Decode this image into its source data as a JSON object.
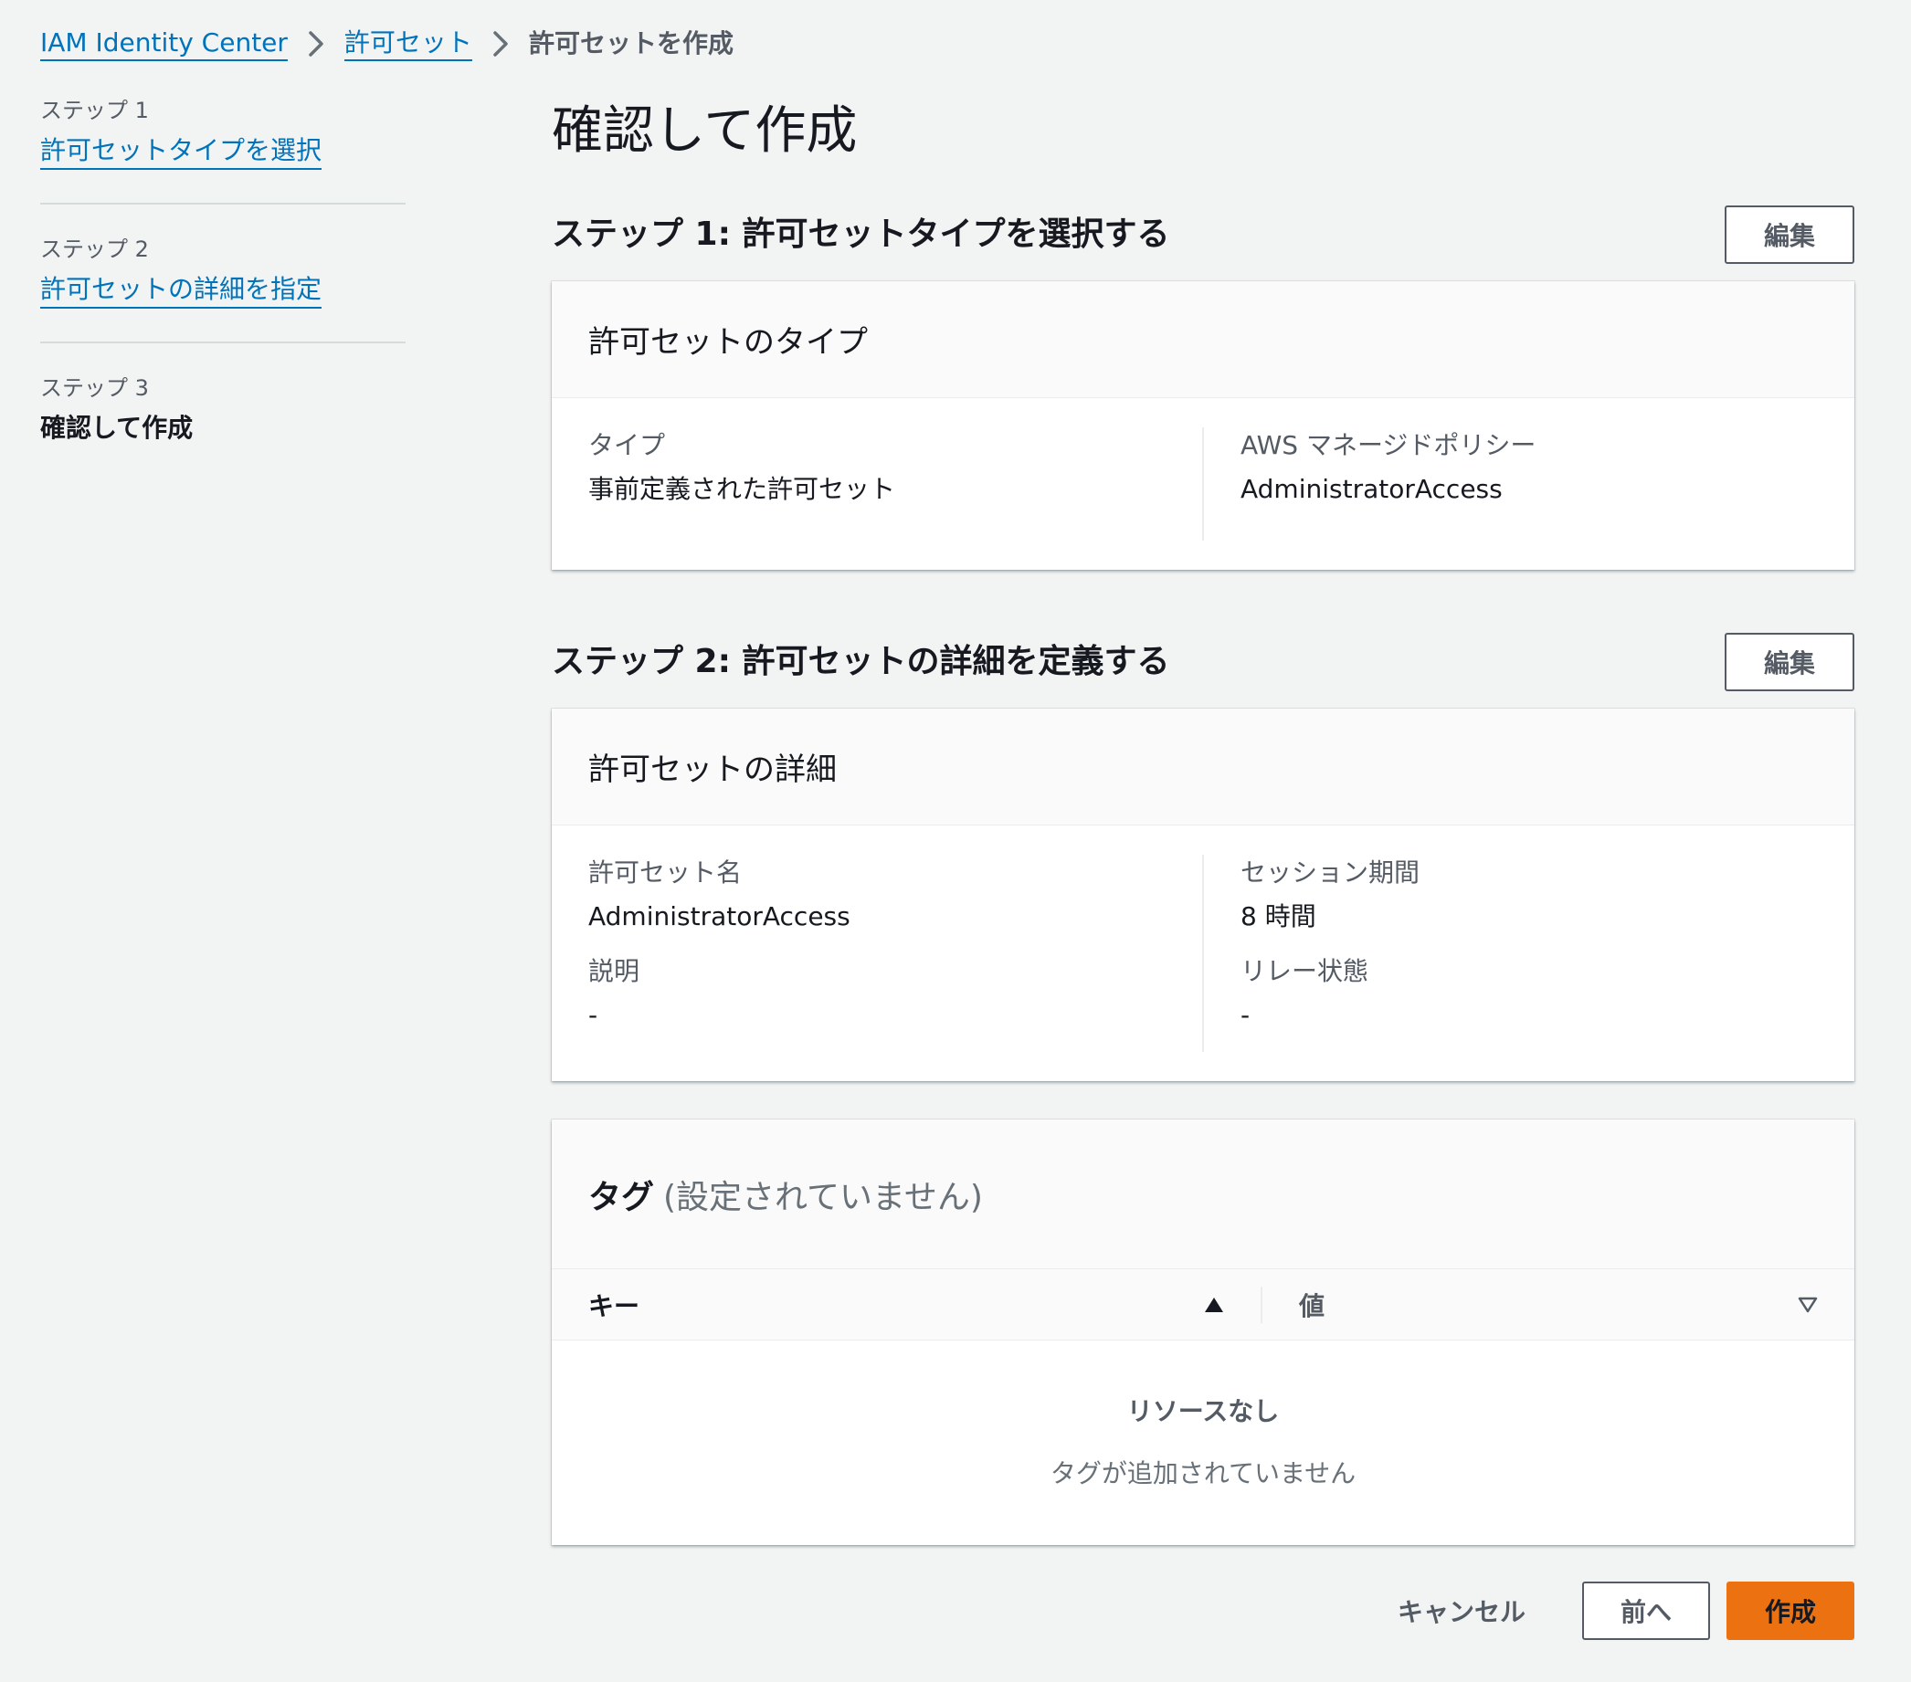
{
  "breadcrumb": {
    "items": [
      {
        "label": "IAM Identity Center"
      },
      {
        "label": "許可セット"
      }
    ],
    "current": "許可セットを作成"
  },
  "side_nav": {
    "steps": [
      {
        "step_label": "ステップ 1",
        "title": "許可セットタイプを選択"
      },
      {
        "step_label": "ステップ 2",
        "title": "許可セットの詳細を指定"
      },
      {
        "step_label": "ステップ 3",
        "title": "確認して作成"
      }
    ]
  },
  "page": {
    "title": "確認して作成"
  },
  "section1": {
    "title": "ステップ 1: 許可セットタイプを選択する",
    "edit_label": "編集",
    "card_title": "許可セットのタイプ",
    "type_label": "タイプ",
    "type_value": "事前定義された許可セット",
    "policy_label": "AWS マネージドポリシー",
    "policy_value": "AdministratorAccess"
  },
  "section2": {
    "title": "ステップ 2: 許可セットの詳細を定義する",
    "edit_label": "編集",
    "card_title": "許可セットの詳細",
    "name_label": "許可セット名",
    "name_value": "AdministratorAccess",
    "desc_label": "説明",
    "desc_value": "-",
    "session_label": "セッション期間",
    "session_value": "8 時間",
    "relay_label": "リレー状態",
    "relay_value": "-"
  },
  "tags": {
    "title": "タグ",
    "count_text": "(設定されていません)",
    "columns": [
      "キー",
      "値"
    ],
    "empty_title": "リソースなし",
    "empty_desc": "タグが追加されていません"
  },
  "footer": {
    "cancel_label": "キャンセル",
    "prev_label": "前へ",
    "create_label": "作成"
  },
  "colors": {
    "link": "#0073bb",
    "primary": "#ec7211",
    "background": "#f2f3f3"
  }
}
